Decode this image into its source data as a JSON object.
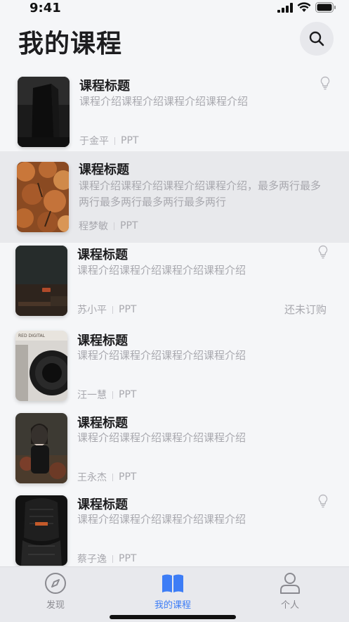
{
  "status_bar": {
    "time": "9:41",
    "icons": [
      "signal-icon",
      "wifi-icon",
      "battery-icon"
    ]
  },
  "header": {
    "title": "我的课程",
    "search_icon": "search-icon"
  },
  "courses": [
    {
      "title": "课程标题",
      "description": "课程介绍课程介绍课程介绍课程介绍",
      "author": "于金平",
      "format": "PPT",
      "status": "",
      "has_bulb": true,
      "thumb": "dark-skyscraper"
    },
    {
      "title": "课程标题",
      "description": "课程介绍课程介绍课程介绍课程介绍，最多两行最多两行最多两行最多两行最多两行",
      "author": "程梦敏",
      "format": "PPT",
      "status": "",
      "has_bulb": false,
      "thumb": "autumn-trees"
    },
    {
      "title": "课程标题",
      "description": "课程介绍课程介绍课程介绍课程介绍",
      "author": "苏小平",
      "format": "PPT",
      "status": "还未订购",
      "has_bulb": true,
      "thumb": "dark-desk"
    },
    {
      "title": "课程标题",
      "description": "课程介绍课程介绍课程介绍课程介绍",
      "author": "汪一慧",
      "format": "PPT",
      "status": "",
      "has_bulb": false,
      "thumb": "camera-lens"
    },
    {
      "title": "课程标题",
      "description": "课程介绍课程介绍课程介绍课程介绍",
      "author": "王永杰",
      "format": "PPT",
      "status": "",
      "has_bulb": false,
      "thumb": "portrait-woman"
    },
    {
      "title": "课程标题",
      "description": "课程介绍课程介绍课程介绍课程介绍",
      "author": "蔡子逸",
      "format": "PPT",
      "status": "",
      "has_bulb": true,
      "thumb": "car-seat"
    }
  ],
  "tabbar": {
    "tabs": [
      {
        "label": "发现",
        "icon": "compass-icon",
        "active": false
      },
      {
        "label": "我的课程",
        "icon": "book-icon",
        "active": true
      },
      {
        "label": "个人",
        "icon": "person-icon",
        "active": false
      }
    ]
  },
  "colors": {
    "accent": "#3d7df6",
    "inactive": "#8a8a90",
    "title": "#1d1d1f",
    "secondary": "#a8a8ae"
  }
}
